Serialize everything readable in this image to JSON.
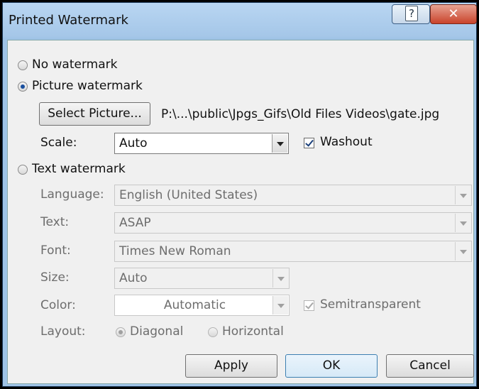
{
  "window": {
    "title": "Printed Watermark"
  },
  "options": {
    "no_watermark": "No watermark",
    "picture_watermark": "Picture watermark",
    "text_watermark": "Text watermark"
  },
  "picture": {
    "select_button": "Select Picture...",
    "path": "P:\\...\\public\\Jpgs_Gifs\\Old Files Videos\\gate.jpg",
    "scale_label": "Scale:",
    "scale_value": "Auto",
    "washout_label": "Washout"
  },
  "text": {
    "language_label": "Language:",
    "language_value": "English (United States)",
    "text_label": "Text:",
    "text_value": "ASAP",
    "font_label": "Font:",
    "font_value": "Times New Roman",
    "size_label": "Size:",
    "size_value": "Auto",
    "color_label": "Color:",
    "color_value": "Automatic",
    "semitransparent_label": "Semitransparent",
    "layout_label": "Layout:",
    "layout_diagonal": "Diagonal",
    "layout_horizontal": "Horizontal"
  },
  "buttons": {
    "apply": "Apply",
    "ok": "OK",
    "cancel": "Cancel"
  },
  "colors": {
    "title_bar": "#a4c6e8",
    "close_button": "#c9432b",
    "dialog_bg": "#f0f0f0"
  }
}
